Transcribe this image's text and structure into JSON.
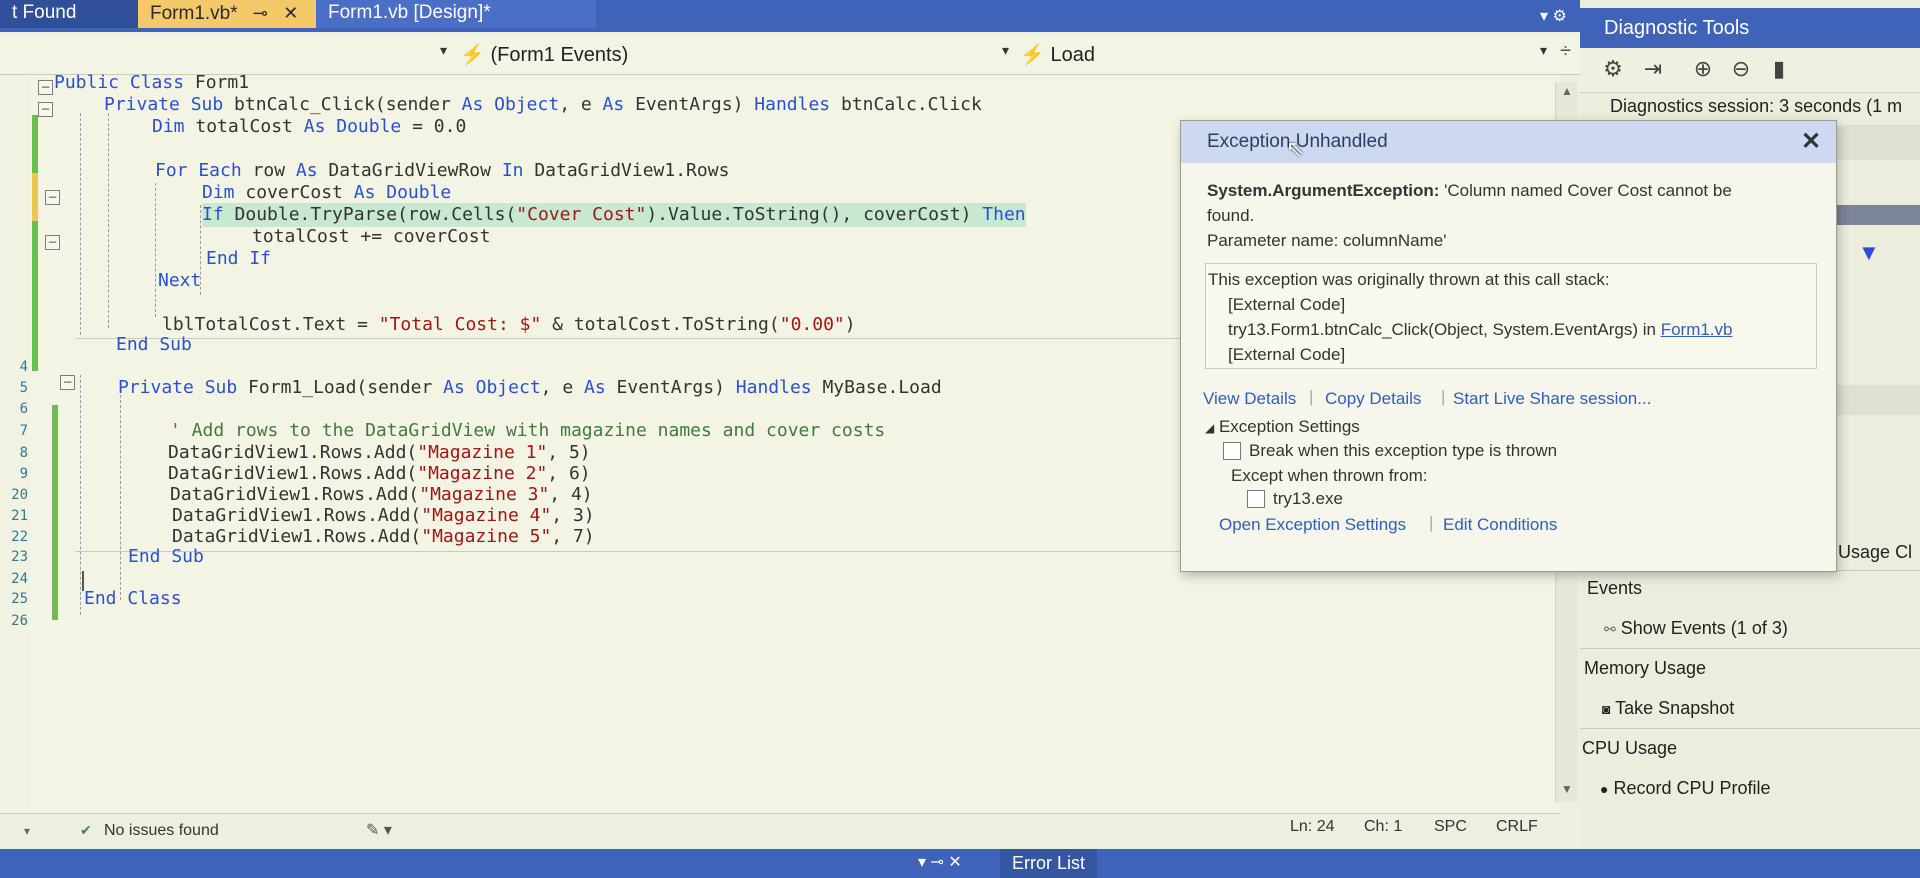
{
  "tabs": {
    "found": "t Found",
    "form1vb": "Form1.vb*",
    "form1vb_pin": "⊸",
    "form1vb_close": "✕",
    "design": "Form1.vb [Design]*"
  },
  "nav": {
    "events": "(Form1 Events)",
    "method": "Load",
    "lightning": "⚡"
  },
  "line_numbers": [
    "",
    "",
    "",
    "",
    "",
    "",
    "",
    "",
    "",
    "",
    "",
    "",
    "",
    "4",
    "5",
    "6",
    "7",
    "8",
    "9",
    "20",
    "21",
    "22",
    "23",
    "24",
    "25",
    "26"
  ],
  "code": {
    "l1a": "Public Class",
    "l1b": " Form1",
    "l2a": "Private Sub",
    "l2b": " btnCalc_Click(sender ",
    "l2c": "As Object",
    "l2d": ", e ",
    "l2e": "As",
    "l2f": " EventArgs) ",
    "l2g": "Handles",
    "l2h": " btnCalc.Click",
    "l3a": "Dim",
    "l3b": " totalCost ",
    "l3c": "As Double",
    "l3d": " = 0.0",
    "l5a": "For Each",
    "l5b": " row ",
    "l5c": "As",
    "l5d": " DataGridViewRow ",
    "l5e": "In",
    "l5f": " DataGridView1.Rows",
    "l6a": "Dim",
    "l6b": " coverCost ",
    "l6c": "As Double",
    "l7a": "If",
    "l7b": " Double.TryParse(row.Cells(",
    "l7c": "\"Cover Cost\"",
    "l7d": ").Value.ToString(), coverCost) ",
    "l7e": "Then",
    "l8": "totalCost += coverCost",
    "l9": "End If",
    "l10": "Next",
    "l12a": "lblTotalCost.Text = ",
    "l12b": "\"Total Cost: $\"",
    "l12c": " & totalCost.ToString(",
    "l12d": "\"0.00\"",
    "l12e": ")",
    "l13": "End Sub",
    "l15a": "Private Sub",
    "l15b": " Form1_Load(sender ",
    "l15c": "As Object",
    "l15d": ", e ",
    "l15e": "As",
    "l15f": " EventArgs) ",
    "l15g": "Handles",
    "l15h": " MyBase.Load",
    "l17": "' Add rows to the DataGridView with magazine names and cover costs",
    "rows": [
      {
        "a": "DataGridView1.Rows.Add(",
        "b": "\"Magazine 1\"",
        "c": ", 5)"
      },
      {
        "a": "DataGridView1.Rows.Add(",
        "b": "\"Magazine 2\"",
        "c": ", 6)"
      },
      {
        "a": "DataGridView1.Rows.Add(",
        "b": "\"Magazine 3\"",
        "c": ", 4)"
      },
      {
        "a": "DataGridView1.Rows.Add(",
        "b": "\"Magazine 4\"",
        "c": ", 3)"
      },
      {
        "a": "DataGridView1.Rows.Add(",
        "b": "\"Magazine 5\"",
        "c": ", 7)"
      }
    ],
    "l23": "End Sub",
    "l25": "End Class"
  },
  "status": {
    "issues": "No issues found",
    "ln": "Ln: 24",
    "ch": "Ch: 1",
    "spc": "SPC",
    "crlf": "CRLF"
  },
  "bottom": {
    "error_list": "Error List"
  },
  "diag": {
    "title": "Diagnostic Tools",
    "session": "Diagnostics session: 3 seconds (1 m",
    "memory_usage_tab": "ory Usage",
    "cpu_tab": "Cl",
    "events_header": "Events",
    "show_events": "Show Events (1 of 3)",
    "memory_usage": "Memory Usage",
    "take_snapshot": "Take Snapshot",
    "cpu_usage": "CPU Usage",
    "record_cpu": "Record CPU Profile"
  },
  "exception": {
    "title": "Exception Unhandled",
    "type": "System.ArgumentException:",
    "message1": " 'Column named Cover Cost cannot be",
    "message2": "found.",
    "param": "Parameter name: columnName'",
    "stack_title": "This exception was originally thrown at this call stack:",
    "stack1": "[External Code]",
    "stack2a": "try13.Form1.btnCalc_Click(Object, System.EventArgs) in ",
    "stack2b": "Form1.vb",
    "stack3": "[External Code]",
    "view_details": "View Details",
    "copy_details": "Copy Details",
    "live_share": "Start Live Share session...",
    "settings_header": "Exception Settings",
    "break_when": "Break when this exception type is thrown",
    "except_when": "Except when thrown from:",
    "try13": "try13.exe",
    "open_settings": "Open Exception Settings",
    "edit_conditions": "Edit Conditions"
  }
}
